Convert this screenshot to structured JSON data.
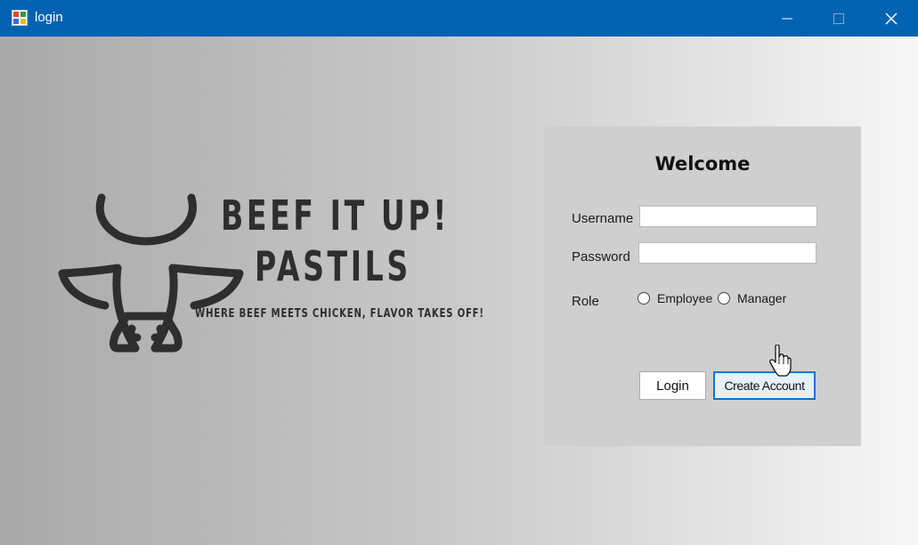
{
  "window": {
    "title": "login"
  },
  "brand": {
    "line1": "BEEF IT UP!",
    "line2": "PASTILS",
    "tagline": "WHERE BEEF MEETS CHICKEN, FLAVOR TAKES OFF!"
  },
  "login_panel": {
    "heading": "Welcome",
    "username_label": "Username",
    "username_value": "",
    "password_label": "Password",
    "password_value": "",
    "role_label": "Role",
    "role_options": [
      "Employee",
      "Manager"
    ],
    "login_button": "Login",
    "create_account_button": "Create Account"
  },
  "colors": {
    "titlebar": "#0063b1",
    "panel": "#cfcfcf",
    "accent": "#0078d7",
    "logo_ink": "#2e2e2e"
  },
  "icons": [
    "app-icon",
    "minimize-icon",
    "maximize-icon",
    "close-icon",
    "cow-head-icon",
    "hand-cursor-icon"
  ]
}
